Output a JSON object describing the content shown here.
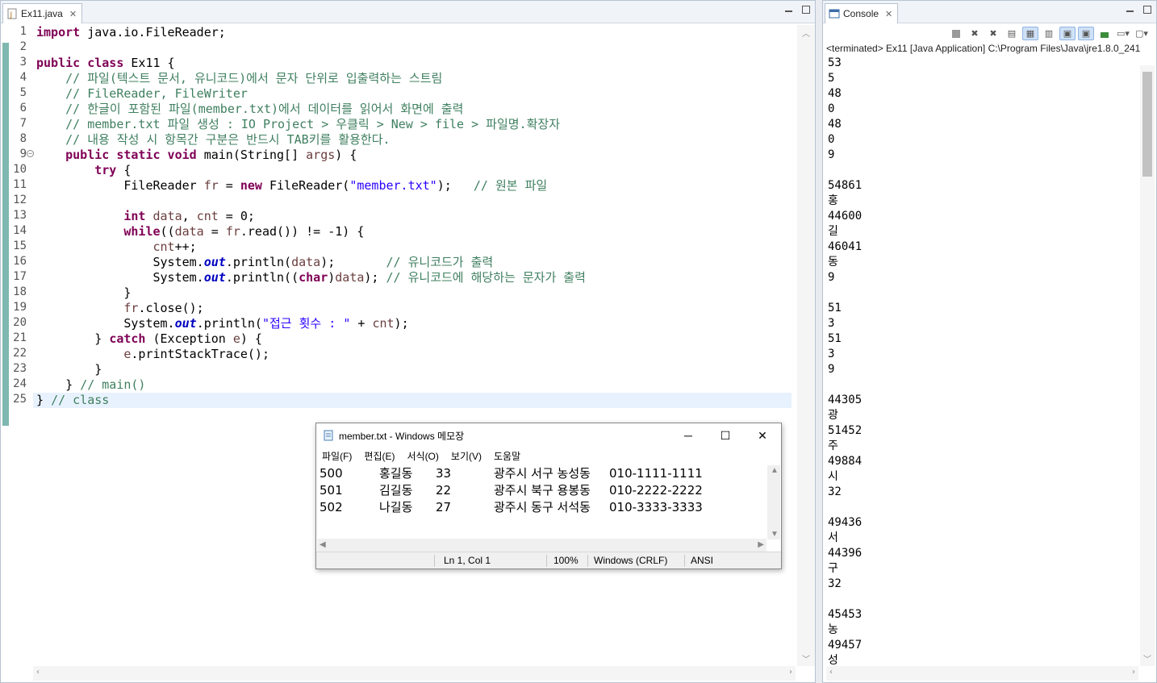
{
  "editor": {
    "tab_title": "Ex11.java",
    "lines": [
      {
        "n": "1"
      },
      {
        "n": "2"
      },
      {
        "n": "3"
      },
      {
        "n": "4"
      },
      {
        "n": "5"
      },
      {
        "n": "6"
      },
      {
        "n": "7"
      },
      {
        "n": "8"
      },
      {
        "n": "9"
      },
      {
        "n": "10"
      },
      {
        "n": "11"
      },
      {
        "n": "12"
      },
      {
        "n": "13"
      },
      {
        "n": "14"
      },
      {
        "n": "15"
      },
      {
        "n": "16"
      },
      {
        "n": "17"
      },
      {
        "n": "18"
      },
      {
        "n": "19"
      },
      {
        "n": "20"
      },
      {
        "n": "21"
      },
      {
        "n": "22"
      },
      {
        "n": "23"
      },
      {
        "n": "24"
      },
      {
        "n": "25"
      }
    ],
    "code": {
      "l1_kw": "import",
      "l1_rest": " java.io.FileReader;",
      "l3_kw1": "public",
      "l3_kw2": "class",
      "l3_rest": " Ex11 {",
      "l4": "    // 파일(텍스트 문서, 유니코드)에서 문자 단위로 입출력하는 스트림",
      "l5": "    // FileReader, FileWriter",
      "l6": "    // 한글이 포함된 파일(member.txt)에서 데이터를 읽어서 화면에 출력",
      "l7": "    // member.txt 파일 생성 : IO Project > 우클릭 > New > file > 파일명.확장자",
      "l8": "    // 내용 작성 시 항목간 구분은 반드시 TAB키를 활용한다.",
      "l9_pre": "    ",
      "l9_kw": "public static void",
      "l9_rest": " main(String[] ",
      "l9_var": "args",
      "l9_end": ") {",
      "l10_pre": "        ",
      "l10_kw": "try",
      "l10_rest": " {",
      "l11_pre": "            FileReader ",
      "l11_var": "fr",
      "l11_mid": " = ",
      "l11_kw": "new",
      "l11_mid2": " FileReader(",
      "l11_str": "\"member.txt\"",
      "l11_end": ");   ",
      "l11_cm": "// 원본 파일",
      "l13_pre": "            ",
      "l13_kw": "int",
      "l13_sp": " ",
      "l13_v1": "data",
      "l13_c": ", ",
      "l13_v2": "cnt",
      "l13_end": " = 0;",
      "l14_pre": "            ",
      "l14_kw": "while",
      "l14_a": "((",
      "l14_v1": "data",
      "l14_b": " = ",
      "l14_v2": "fr",
      "l14_c": ".read()) != -1) {",
      "l15_pre": "                ",
      "l15_v": "cnt",
      "l15_end": "++;",
      "l16_pre": "                System.",
      "l16_f": "out",
      "l16_a": ".println(",
      "l16_v": "data",
      "l16_b": ");       ",
      "l16_cm": "// 유니코드가 출력",
      "l17_pre": "                System.",
      "l17_f": "out",
      "l17_a": ".println((",
      "l17_kw": "char",
      "l17_b": ")",
      "l17_v": "data",
      "l17_c": "); ",
      "l17_cm": "// 유니코드에 해당하는 문자가 출력",
      "l18": "            }",
      "l19_pre": "            ",
      "l19_v": "fr",
      "l19_end": ".close();",
      "l20_pre": "            System.",
      "l20_f": "out",
      "l20_a": ".println(",
      "l20_str": "\"접근 횟수 : \"",
      "l20_b": " + ",
      "l20_v": "cnt",
      "l20_end": ");",
      "l21_pre": "        } ",
      "l21_kw": "catch",
      "l21_a": " (Exception ",
      "l21_v": "e",
      "l21_end": ") {",
      "l22_pre": "            ",
      "l22_v": "e",
      "l22_end": ".printStackTrace();",
      "l23": "        }",
      "l24_pre": "    } ",
      "l24_cm": "// main()",
      "l25_pre": "} ",
      "l25_cm": "// class"
    }
  },
  "console": {
    "tab_title": "Console",
    "terminated": "<terminated> Ex11 [Java Application] C:\\Program Files\\Java\\jre1.8.0_241",
    "output": [
      "53",
      "5",
      "48",
      "0",
      "48",
      "0",
      "9",
      "",
      "54861",
      "홍",
      "44600",
      "길",
      "46041",
      "동",
      "9",
      "",
      "51",
      "3",
      "51",
      "3",
      "9",
      "",
      "44305",
      "광",
      "51452",
      "주",
      "49884",
      "시",
      "32",
      "",
      "49436",
      "서",
      "44396",
      "구",
      "32",
      "",
      "45453",
      "농",
      "49457",
      "성"
    ]
  },
  "notepad": {
    "title": "member.txt - Windows 메모장",
    "menu": [
      "파일(F)",
      "편집(E)",
      "서식(O)",
      "보기(V)",
      "도움말"
    ],
    "rows": [
      {
        "id": "500",
        "name": "홍길동",
        "age": "33",
        "addr": "광주시 서구 농성동",
        "phone": "010-1111-1111"
      },
      {
        "id": "501",
        "name": "김길동",
        "age": "22",
        "addr": "광주시 북구 용봉동",
        "phone": "010-2222-2222"
      },
      {
        "id": "502",
        "name": "나길동",
        "age": "27",
        "addr": "광주시 동구 서석동",
        "phone": "010-3333-3333"
      }
    ],
    "status": {
      "position": "Ln 1, Col 1",
      "zoom": "100%",
      "eol": "Windows (CRLF)",
      "encoding": "ANSI"
    }
  }
}
